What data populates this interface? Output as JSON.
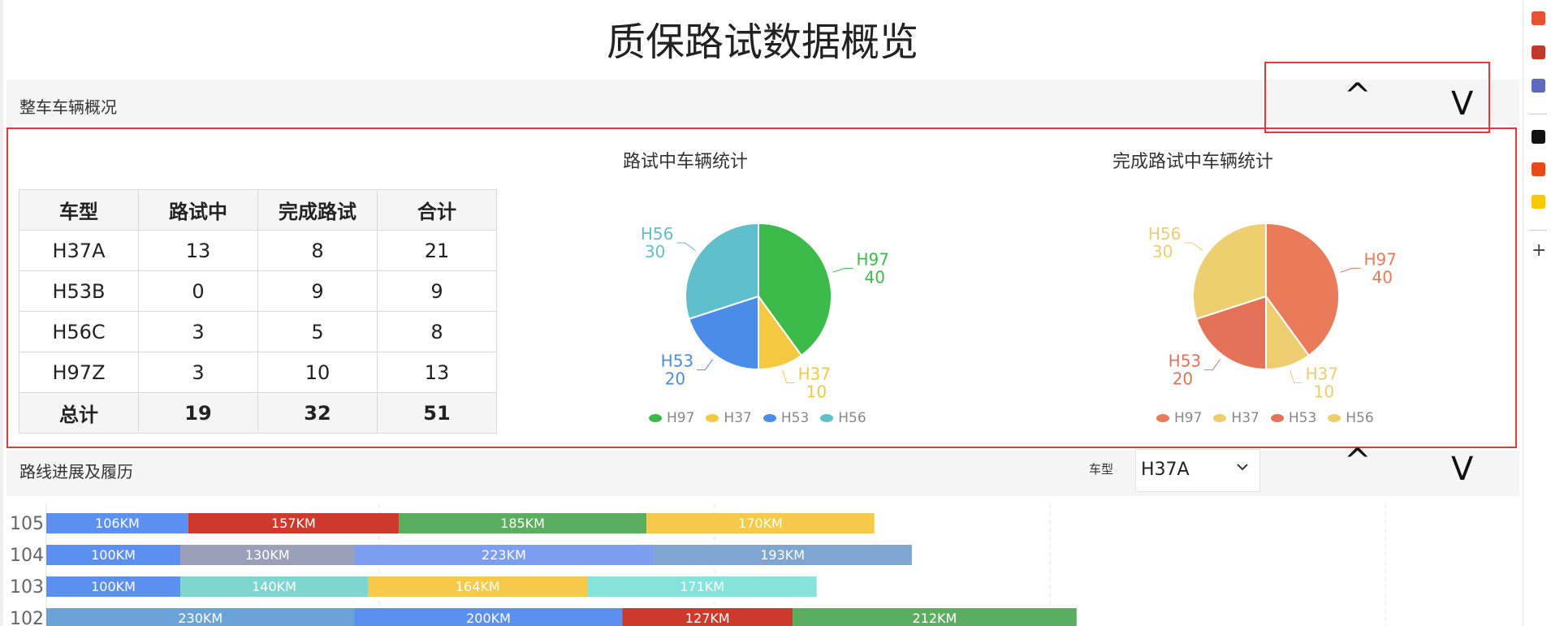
{
  "page_title": "质保路试数据概览",
  "section_vehicle": {
    "label": "整车车辆概况",
    "collapse_label": "^",
    "expand_label": "V"
  },
  "summary_table": {
    "headers": [
      "车型",
      "路试中",
      "完成路试",
      "合计"
    ],
    "rows": [
      [
        "H37A",
        "13",
        "8",
        "21"
      ],
      [
        "H53B",
        "0",
        "9",
        "9"
      ],
      [
        "H56C",
        "3",
        "5",
        "8"
      ],
      [
        "H97Z",
        "3",
        "10",
        "13"
      ]
    ],
    "total": [
      "总计",
      "19",
      "32",
      "51"
    ]
  },
  "chart_data": [
    {
      "type": "pie",
      "title": "路试中车辆统计",
      "categories": [
        "H97",
        "H37",
        "H53",
        "H56"
      ],
      "values": [
        40,
        10,
        20,
        30
      ],
      "colors": [
        "#3dbb4a",
        "#f5c842",
        "#4a8ce8",
        "#5fc0cc"
      ],
      "legend": "bottom",
      "labels": [
        "H97\n40",
        "H37\n10",
        "H53\n20",
        "H56\n30"
      ]
    },
    {
      "type": "pie",
      "title": "完成路试中车辆统计",
      "categories": [
        "H97",
        "H37",
        "H53",
        "H56"
      ],
      "values": [
        40,
        10,
        20,
        30
      ],
      "colors": [
        "#e97a5a",
        "#edcd70",
        "#e37258",
        "#edcf70"
      ],
      "legend": "bottom",
      "labels": [
        "H97\n40",
        "H37\n10",
        "H53\n20",
        "H56\n30"
      ]
    },
    {
      "type": "bar",
      "orientation": "horizontal-stacked",
      "categories": [
        "105",
        "104",
        "103",
        "102"
      ],
      "segments": [
        [
          {
            "value": 106,
            "label": "106KM",
            "color": "#5b8ff0"
          },
          {
            "value": 157,
            "label": "157KM",
            "color": "#cd3a2c"
          },
          {
            "value": 185,
            "label": "185KM",
            "color": "#5bae5f"
          },
          {
            "value": 170,
            "label": "170KM",
            "color": "#f7c948"
          }
        ],
        [
          {
            "value": 100,
            "label": "100KM",
            "color": "#5b8ff0"
          },
          {
            "value": 130,
            "label": "130KM",
            "color": "#9aa0b8"
          },
          {
            "value": 223,
            "label": "223KM",
            "color": "#7b9ef0"
          },
          {
            "value": 193,
            "label": "193KM",
            "color": "#7fa6d0"
          }
        ],
        [
          {
            "value": 100,
            "label": "100KM",
            "color": "#5b8ff0"
          },
          {
            "value": 140,
            "label": "140KM",
            "color": "#7ed6d1"
          },
          {
            "value": 164,
            "label": "164KM",
            "color": "#f7c948"
          },
          {
            "value": 171,
            "label": "171KM",
            "color": "#86e3dc"
          }
        ],
        [
          {
            "value": 230,
            "label": "230KM",
            "color": "#6aa3d8"
          },
          {
            "value": 200,
            "label": "200KM",
            "color": "#5b8ff0"
          },
          {
            "value": 127,
            "label": "127KM",
            "color": "#cd3a2c"
          },
          {
            "value": 212,
            "label": "212KM",
            "color": "#5bae5f"
          }
        ]
      ],
      "grid": true
    }
  ],
  "section_route": {
    "label": "路线进展及履历",
    "filter_label": "车型",
    "filter_value": "H37A",
    "collapse_label": "^",
    "expand_label": "V"
  },
  "right_rail_icons": [
    "office-icon",
    "toolbox-icon",
    "chess-icon",
    "tiktok-icon",
    "weibo-icon",
    "meituan-icon",
    "plus-icon"
  ]
}
